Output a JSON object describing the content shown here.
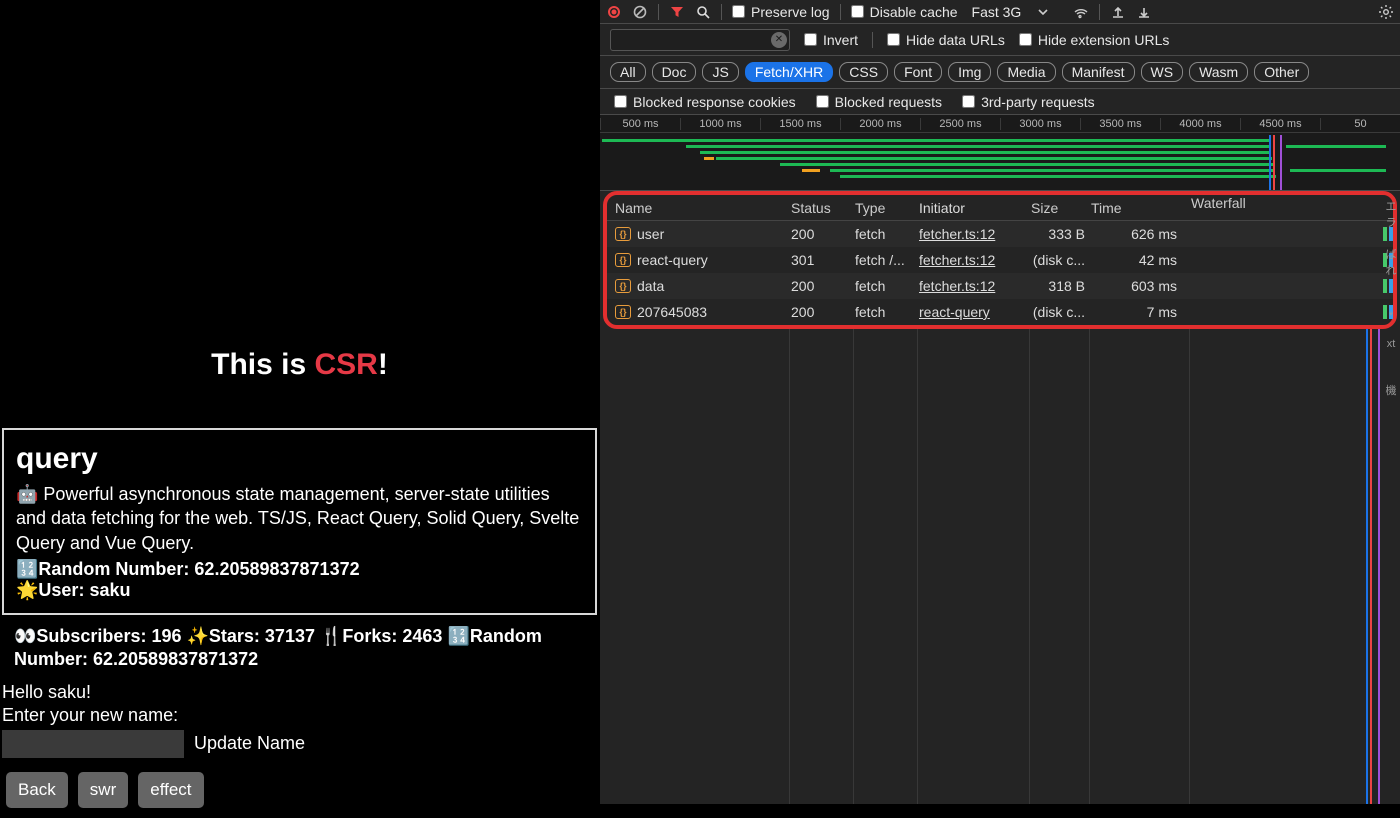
{
  "page": {
    "title_pre": "This is ",
    "title_em": "CSR",
    "title_post": "!",
    "heading": "query",
    "description": "🤖 Powerful asynchronous state management, server-state utilities and data fetching for the web. TS/JS, React Query, Solid Query, Svelte Query and Vue Query.",
    "random_label": "🔢Random Number: ",
    "random_value": "62.20589837871372",
    "user_label": "🌟User: ",
    "user_value": "saku",
    "stats": "👀Subscribers: 196 ✨Stars: 37137 🍴Forks: 2463 🔢Random Number: 62.20589837871372",
    "hello": "Hello saku!",
    "enter_name": "Enter your new name:",
    "update_name": "Update Name",
    "buttons": {
      "back": "Back",
      "swr": "swr",
      "effect": "effect"
    }
  },
  "toolbar": {
    "preserve_log": "Preserve log",
    "disable_cache": "Disable cache",
    "throttle": "Fast 3G"
  },
  "filterbar": {
    "invert": "Invert",
    "hide_data": "Hide data URLs",
    "hide_ext": "Hide extension URLs"
  },
  "chips": [
    "All",
    "Doc",
    "JS",
    "Fetch/XHR",
    "CSS",
    "Font",
    "Img",
    "Media",
    "Manifest",
    "WS",
    "Wasm",
    "Other"
  ],
  "active_chip": "Fetch/XHR",
  "checkrow": {
    "blocked_resp": "Blocked response cookies",
    "blocked_req": "Blocked requests",
    "third_party": "3rd-party requests"
  },
  "ticks": [
    "500 ms",
    "1000 ms",
    "1500 ms",
    "2000 ms",
    "2500 ms",
    "3000 ms",
    "3500 ms",
    "4000 ms",
    "4500 ms",
    "50"
  ],
  "columns": [
    "Name",
    "Status",
    "Type",
    "Initiator",
    "Size",
    "Time",
    "Waterfall"
  ],
  "rows": [
    {
      "name": "user",
      "status": "200",
      "type": "fetch",
      "initiator": "fetcher.ts:12",
      "size": "333 B",
      "time": "626 ms"
    },
    {
      "name": "react-query",
      "status": "301",
      "type": "fetch /...",
      "initiator": "fetcher.ts:12",
      "size": "(disk c...",
      "time": "42 ms"
    },
    {
      "name": "data",
      "status": "200",
      "type": "fetch",
      "initiator": "fetcher.ts:12",
      "size": "318 B",
      "time": "603 ms"
    },
    {
      "name": "207645083",
      "status": "200",
      "type": "fetch",
      "initiator": "react-query",
      "size": "(disk c...",
      "time": "7 ms"
    }
  ],
  "annotations": [
    "エラ",
    "ばれ",
    "",
    "*",
    "xt",
    "",
    "機"
  ]
}
